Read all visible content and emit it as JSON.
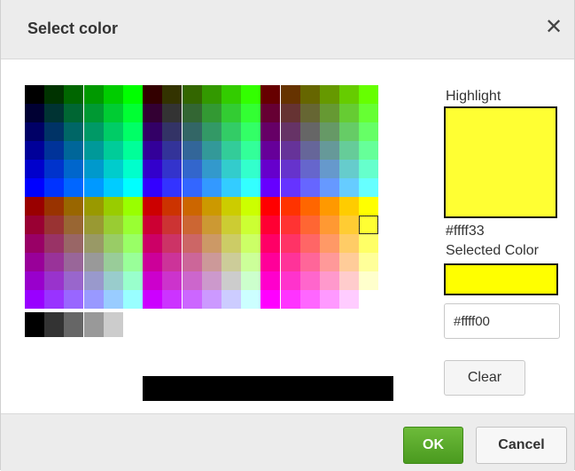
{
  "dialog": {
    "title": "Select color",
    "close_icon": "close-icon"
  },
  "palette": {
    "selected_color": "#ffff33",
    "grayscale": [
      "#000000",
      "#333333",
      "#666666",
      "#999999",
      "#cccccc",
      "#ffffff"
    ]
  },
  "highlight": {
    "label": "Highlight",
    "color": "#ffff33",
    "hex": "#ffff33"
  },
  "selected": {
    "label": "Selected Color",
    "color": "#ffff00",
    "input_value": "#ffff00"
  },
  "buttons": {
    "clear": "Clear",
    "ok": "OK",
    "cancel": "Cancel"
  }
}
